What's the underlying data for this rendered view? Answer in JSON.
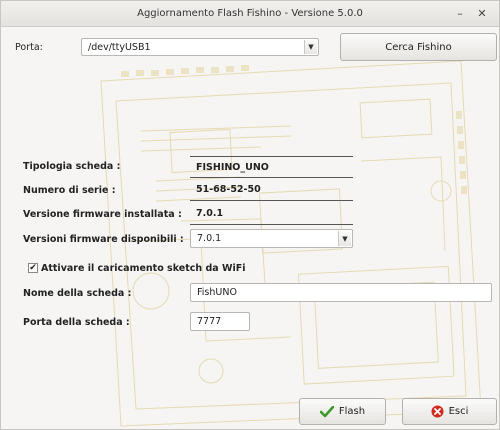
{
  "window": {
    "title": "Aggiornamento Flash Fishino - Versione 5.0.0",
    "minimize_label": "–",
    "close_label": "✕"
  },
  "port": {
    "label": "Porta:",
    "value": "/dev/ttyUSB1",
    "search_button": "Cerca Fishino"
  },
  "board_info": {
    "type_label": "Tipologia scheda :",
    "type_value": "FISHINO_UNO",
    "serial_label": "Numero di serie :",
    "serial_value": "51-68-52-50",
    "fw_installed_label": "Versione firmware installata :",
    "fw_installed_value": "7.0.1",
    "fw_available_label": "Versioni firmware disponibili :",
    "fw_available_value": "7.0.1"
  },
  "wifi": {
    "checkbox_label": "Attivare il caricamento sketch da WiFi",
    "checked": true,
    "board_name_label": "Nome della scheda :",
    "board_name_value": "FishUNO",
    "board_port_label": "Porta della scheda :",
    "board_port_value": "7777"
  },
  "actions": {
    "flash_label": "Flash",
    "exit_label": "Esci"
  },
  "colors": {
    "board_trace": "#e8dcb8",
    "flash_icon": "#3a9a2a",
    "exit_icon": "#d42a1e"
  }
}
